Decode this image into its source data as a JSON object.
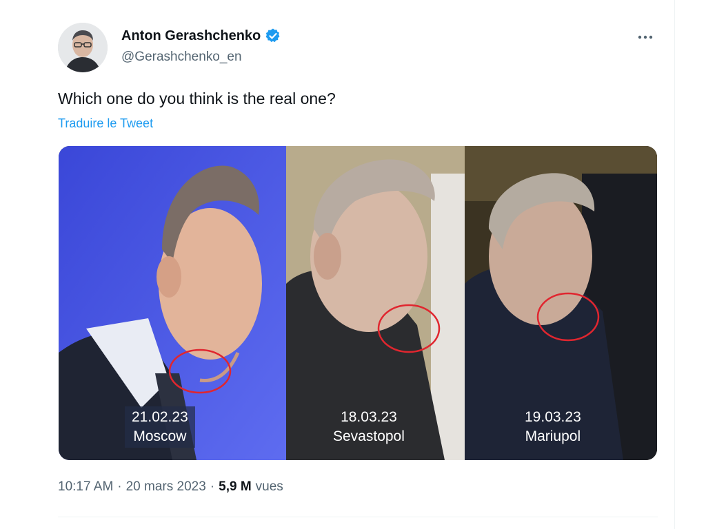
{
  "tweet": {
    "author": {
      "display_name": "Anton Gerashchenko",
      "handle": "@Gerashchenko_en",
      "verified": true,
      "verified_icon": "verified-badge-icon",
      "verified_color": "#1d9bf0"
    },
    "more_icon": "more-dots-icon",
    "text": "Which one do you think is the real one?",
    "translate_label": "Traduire le Tweet",
    "media": {
      "panels": [
        {
          "date": "21.02.23",
          "place": "Moscow"
        },
        {
          "date": "18.03.23",
          "place": "Sevastopol"
        },
        {
          "date": "19.03.23",
          "place": "Mariupol"
        }
      ],
      "highlight_color": "#e0262f"
    },
    "meta": {
      "time": "10:17 AM",
      "separator": "·",
      "date": "20 mars 2023",
      "views_count": "5,9 M",
      "views_label": "vues"
    }
  },
  "colors": {
    "link": "#1d9bf0",
    "secondary_text": "#536471",
    "primary_text": "#0f1419"
  }
}
